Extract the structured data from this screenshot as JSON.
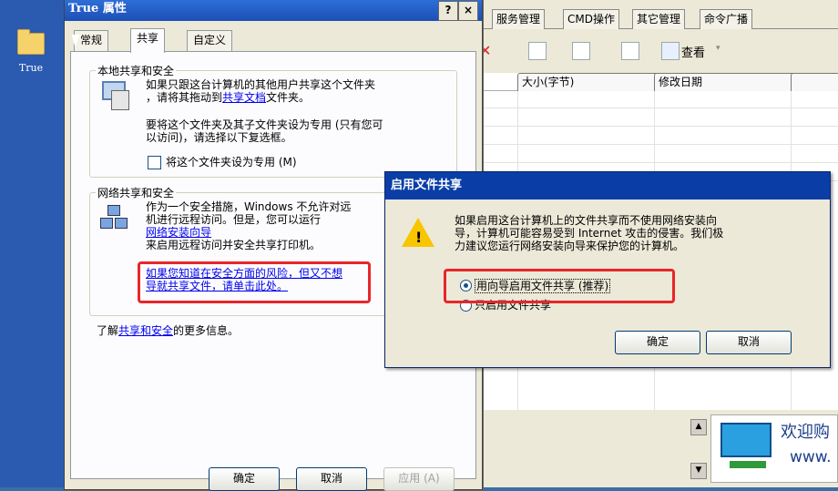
{
  "desktop": {
    "icon_label": "True"
  },
  "app": {
    "tabs": [
      "服务管理",
      "CMD操作",
      "其它管理",
      "命令广播"
    ],
    "toolbar_view_label": "查看",
    "columns": [
      "大小(字节)",
      "修改日期"
    ],
    "welcome_text": "欢迎购",
    "welcome_url": "www."
  },
  "props": {
    "title": "True 属性",
    "help_btn": "?",
    "close_btn": "×",
    "tabs": [
      "常规",
      "共享",
      "自定义"
    ],
    "local_group": {
      "legend": "本地共享和安全",
      "line1": "如果只跟这台计算机的其他用户共享这个文件夹",
      "line2_pre": "，请将其拖动到",
      "line2_link": "共享文档",
      "line2_post": "文件夹。",
      "private_line1": "要将这个文件夹及其子文件夹设为专用 (只有您可",
      "private_line2": "以访问)，请选择以下复选框。",
      "checkbox_label": "将这个文件夹设为专用 (M)"
    },
    "network_group": {
      "legend": "网络共享和安全",
      "line1": "作为一个安全措施，Windows 不允许对远",
      "line2": "机进行远程访问。但是，您可以运行",
      "link_wizard": "网络安装向导",
      "line4": "来启用远程访问并安全共享打印机。",
      "risk_link_line1": "如果您知道在安全方面的风险，但又不想",
      "risk_link_line2": "导就共享文件，请单击此处。"
    },
    "info_pre": "了解",
    "info_link": "共享和安全",
    "info_post": "的更多信息。",
    "buttons": {
      "ok": "确定",
      "cancel": "取消",
      "apply": "应用 (A)"
    }
  },
  "modal": {
    "title": "启用文件共享",
    "msg_line1": "如果启用这台计算机上的文件共享而不使用网络安装向",
    "msg_line2": "导，计算机可能容易受到 Internet 攻击的侵害。我们极",
    "msg_line3": "力建议您运行网络安装向导来保护您的计算机。",
    "option1": "用向导启用文件共享 (推荐)",
    "option2": "只启用文件共享",
    "selected_option": "option1",
    "ok": "确定",
    "cancel": "取消"
  },
  "colors": {
    "highlight_box": "#e8262a",
    "title_blue": "#0a3ea6"
  }
}
